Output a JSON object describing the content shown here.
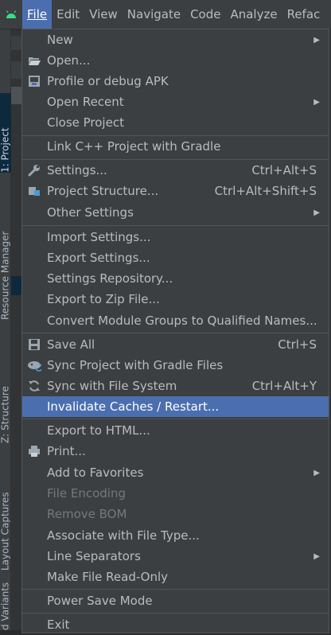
{
  "menubar": {
    "items": [
      "File",
      "Edit",
      "View",
      "Navigate",
      "Code",
      "Analyze",
      "Refac"
    ]
  },
  "toolstrip": {
    "tabs": [
      "1: Project",
      "Resource Manager",
      "Z: Structure",
      "Layout Captures",
      "d Variants"
    ]
  },
  "file_menu": {
    "new": "New",
    "open": "Open...",
    "profile_apk": "Profile or debug APK",
    "open_recent": "Open Recent",
    "close_project": "Close Project",
    "link_cpp": "Link C++ Project with Gradle",
    "settings": "Settings...",
    "settings_shortcut": "Ctrl+Alt+S",
    "project_structure": "Project Structure...",
    "project_structure_shortcut": "Ctrl+Alt+Shift+S",
    "other_settings": "Other Settings",
    "import_settings": "Import Settings...",
    "export_settings": "Export Settings...",
    "settings_repository": "Settings Repository...",
    "export_zip": "Export to Zip File...",
    "convert_module": "Convert Module Groups to Qualified Names...",
    "save_all": "Save All",
    "save_all_shortcut": "Ctrl+S",
    "sync_gradle": "Sync Project with Gradle Files",
    "sync_fs": "Sync with File System",
    "sync_fs_shortcut": "Ctrl+Alt+Y",
    "invalidate_caches": "Invalidate Caches / Restart...",
    "export_html": "Export to HTML...",
    "print": "Print...",
    "add_favorites": "Add to Favorites",
    "file_encoding": "File Encoding",
    "remove_bom": "Remove BOM",
    "associate_type": "Associate with File Type...",
    "line_separators": "Line Separators",
    "make_readonly": "Make File Read-Only",
    "power_save": "Power Save Mode",
    "exit": "Exit"
  },
  "colors": {
    "accent": "#4b6eaf",
    "menu_bg": "#3c3f41",
    "text": "#bbbbbb",
    "disabled": "#777777"
  }
}
